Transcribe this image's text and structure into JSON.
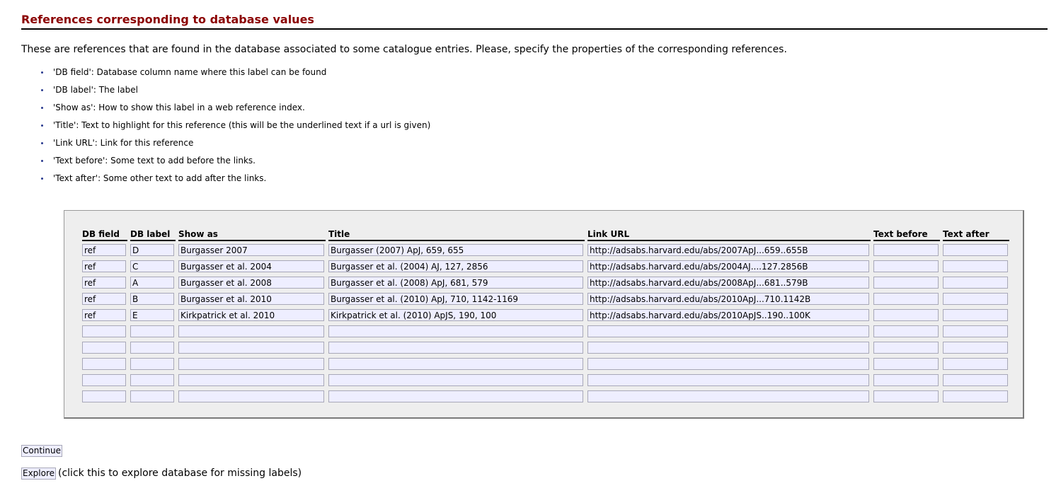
{
  "title": "References corresponding to database values",
  "intro": "These are references that are found in the database associated to some catalogue entries. Please, specify the properties of the corresponding references.",
  "legend": [
    "'DB field': Database column name where this label can be found",
    "'DB label': The label",
    "'Show as': How to show this label in a web reference index.",
    "'Title': Text to highlight for this reference (this will be the underlined text if a url is given)",
    "'Link URL': Link for this reference",
    "'Text before': Some text to add before the links.",
    "'Text after': Some other text to add after the links."
  ],
  "table": {
    "columns": [
      "DB field",
      "DB label",
      "Show as",
      "Title",
      "Link URL",
      "Text before",
      "Text after"
    ],
    "rows": [
      [
        "ref",
        "D",
        "Burgasser 2007",
        "Burgasser (2007) ApJ, 659, 655",
        "http://adsabs.harvard.edu/abs/2007ApJ...659..655B",
        "",
        ""
      ],
      [
        "ref",
        "C",
        "Burgasser et al. 2004",
        "Burgasser et al. (2004) AJ, 127, 2856",
        "http://adsabs.harvard.edu/abs/2004AJ....127.2856B",
        "",
        ""
      ],
      [
        "ref",
        "A",
        "Burgasser et al. 2008",
        "Burgasser et al. (2008) ApJ, 681, 579",
        "http://adsabs.harvard.edu/abs/2008ApJ...681..579B",
        "",
        ""
      ],
      [
        "ref",
        "B",
        "Burgasser et al. 2010",
        "Burgasser et al. (2010) ApJ, 710, 1142-1169",
        "http://adsabs.harvard.edu/abs/2010ApJ...710.1142B",
        "",
        ""
      ],
      [
        "ref",
        "E",
        "Kirkpatrick et al. 2010",
        "Kirkpatrick et al. (2010) ApJS, 190, 100",
        "http://adsabs.harvard.edu/abs/2010ApJS..190..100K",
        "",
        ""
      ],
      [
        "",
        "",
        "",
        "",
        "",
        "",
        ""
      ],
      [
        "",
        "",
        "",
        "",
        "",
        "",
        ""
      ],
      [
        "",
        "",
        "",
        "",
        "",
        "",
        ""
      ],
      [
        "",
        "",
        "",
        "",
        "",
        "",
        ""
      ],
      [
        "",
        "",
        "",
        "",
        "",
        "",
        ""
      ]
    ]
  },
  "buttons": {
    "continue": "Continue",
    "explore": "Explore"
  },
  "explore_note": "(click this to explore database for missing labels)",
  "colors": {
    "title": "#8b0000",
    "input_bg": "#eeeeff",
    "panel_bg": "#eeeeee",
    "bullet": "#2a3b8f"
  }
}
